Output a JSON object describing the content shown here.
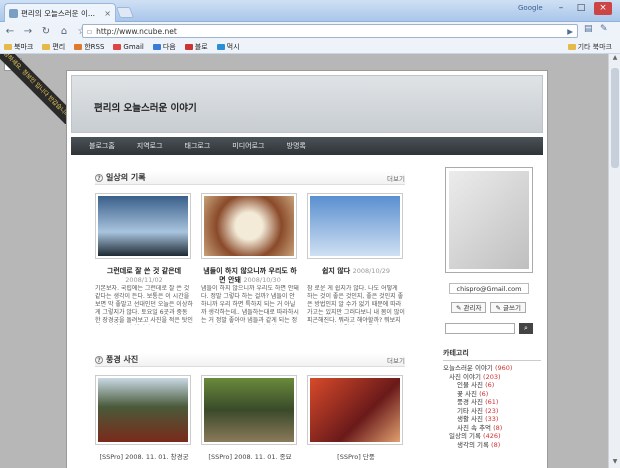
{
  "browser": {
    "tab_title": "편리의 오늘스러운 이...",
    "brand": "Google",
    "address": "http://www.ncube.net"
  },
  "bookmarks": {
    "items": [
      "북마크",
      "편리",
      "한RSS",
      "Gmail",
      "다음",
      "블로",
      "먹시"
    ],
    "other": "기타 북마크"
  },
  "ribbon": {
    "text": "안녕하세요. 정보인 입니다 반갑습니다"
  },
  "blog": {
    "title": "편리의 오늘스러운 이야기",
    "nav": [
      "블로그홈",
      "지역로그",
      "태그로그",
      "미디어로그",
      "방명록"
    ]
  },
  "sections": [
    {
      "title": "일상의 기록",
      "more": "더보기",
      "posts": [
        {
          "title": "그런데로 잘 쓴 것 같은데",
          "date": "2008/11/02",
          "text": "기본보자. 국립에는 그런데로 잘 쓴 것 같다는 생각이 든다. 보통은 이 시간을 보면 막 좋말고 선대인던 오늘은 이상하게 그렇지가 않다. 토요일 6곳과 중동한 장경궁을 돌려보고 사진을 적은 탓인지 몸이 힘들긴 했지만.."
        },
        {
          "title": "냄들이 하지 않으니까 우리도 하면 안돼",
          "date": "2008/10/30",
          "text": "냄들이 하지 않으니까 우리도 하면 안돼다. 정말 그렇다 하는 걸까? 냄들이 안하니까 우리 하면 특하지 되는 거 아닐까 생각하는데.. 냄들하는대로 따라하시는 거 정말 좋아야 냄들과 같게 되는 정도일텐데.. 왜 무모건 따라야할까.."
        },
        {
          "title": "쉽지 않다",
          "date": "2008/10/29",
          "text": "참 로운 게 쉽지가 않다. 나도 어떻게 하는 것이 좋은 것인지, 좋은 것인지 좋은 방법인지 알 수가 없기 때문에 따라가고는 있지만 그러다보니 내 몸이 많이 피곤해진다. 뭐라고 해야할까? 뭐보지 않고서는 어떤 결과가 나올지.."
        }
      ]
    },
    {
      "title": "풍경 사진",
      "more": "더보기",
      "posts": [
        {
          "caption": "[SSPro] 2008. 11. 01. 창경궁"
        },
        {
          "caption": "[SSPro] 2008. 11. 01. 종묘"
        },
        {
          "caption": "[SSPro] 단풍"
        }
      ]
    }
  ],
  "sidebar": {
    "email": "chispro@Gmail.com",
    "admin_btn": "관리자",
    "write_btn": "글쓰기",
    "category_title": "카테고리",
    "categories": [
      {
        "label": "오늘스러운 이야기",
        "count": "(960)"
      },
      {
        "label": "사진 이야기",
        "count": "(203)"
      },
      {
        "label": "인물 사진",
        "count": "(6)"
      },
      {
        "label": "꽃 사진",
        "count": "(6)"
      },
      {
        "label": "풍경 사진",
        "count": "(61)"
      },
      {
        "label": "기타 사진",
        "count": "(23)"
      },
      {
        "label": "생활 사진",
        "count": "(33)"
      },
      {
        "label": "사진 속 추억",
        "count": "(8)"
      },
      {
        "label": "일상의 기록",
        "count": "(426)"
      },
      {
        "label": "생각의 기록",
        "count": "(8)"
      }
    ]
  }
}
